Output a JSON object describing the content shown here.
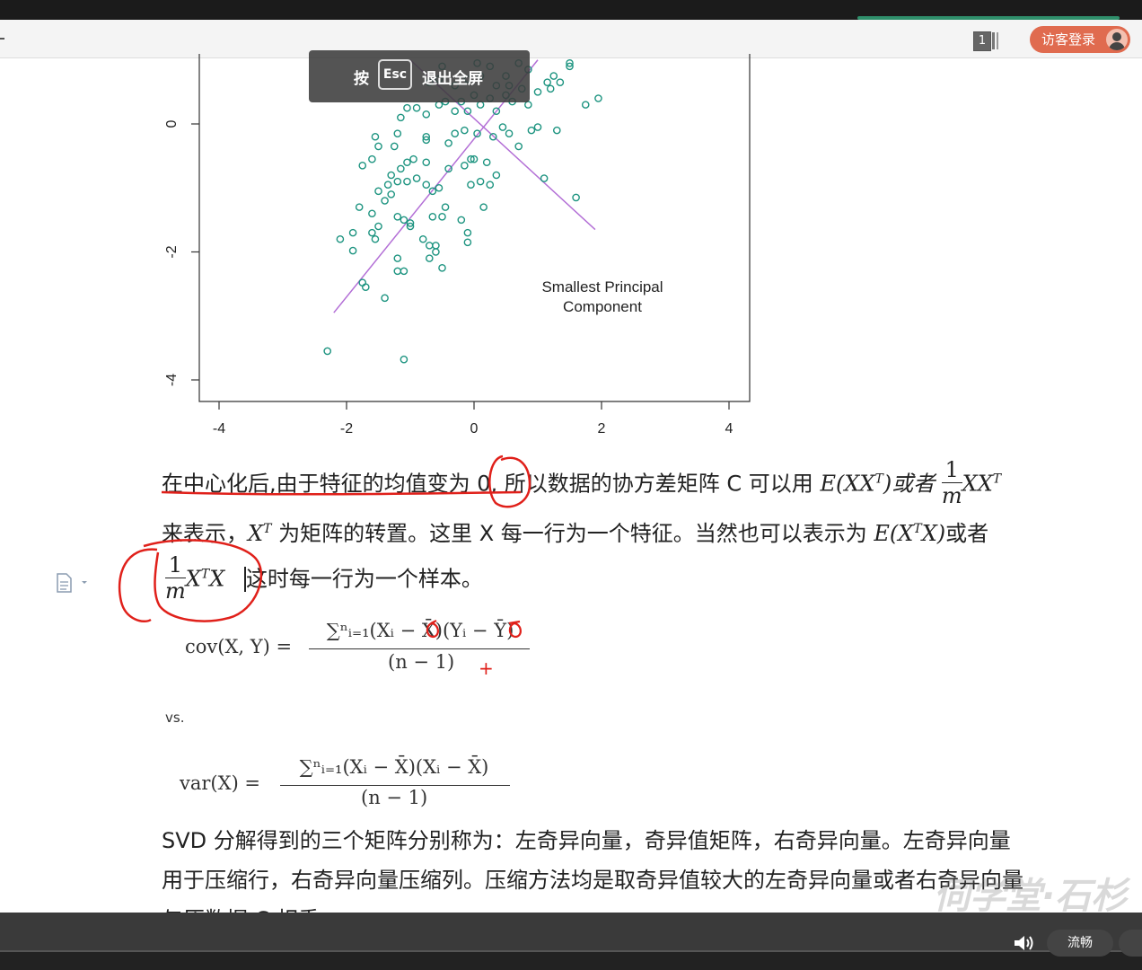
{
  "header": {
    "page_count": "1",
    "visitor_login": "访客登录"
  },
  "fullscreen_hint": {
    "press": "按",
    "key": "Esc",
    "action": "退出全屏"
  },
  "chart_data": {
    "type": "scatter",
    "title": "",
    "annotation_line1": "Smallest Principal",
    "annotation_line2": "Component",
    "xlabel": "",
    "ylabel": "",
    "x_ticks": [
      "-4",
      "-2",
      "0",
      "2",
      "4"
    ],
    "y_ticks": [
      "0",
      "-2",
      "-4"
    ],
    "xlim": [
      -4.4,
      4.4
    ],
    "ylim": [
      -4.3,
      1.1
    ],
    "point_color": "#1d9480",
    "line_color": "#b36fd6",
    "lines": [
      {
        "x": [
          -2.2,
          1.0
        ],
        "y": [
          -2.95,
          1.0
        ]
      },
      {
        "x": [
          -1.0,
          1.9
        ],
        "y": [
          1.0,
          -1.65
        ]
      }
    ],
    "points": [
      [
        -2.3,
        -3.55
      ],
      [
        -1.1,
        -3.68
      ],
      [
        -1.4,
        -2.72
      ],
      [
        -1.75,
        -2.48
      ],
      [
        -1.7,
        -2.55
      ],
      [
        -1.2,
        -2.3
      ],
      [
        -1.1,
        -2.3
      ],
      [
        -1.2,
        -2.1
      ],
      [
        -0.5,
        -2.25
      ],
      [
        -0.7,
        -2.1
      ],
      [
        -0.6,
        -2.0
      ],
      [
        -0.7,
        -1.9
      ],
      [
        -0.8,
        -1.8
      ],
      [
        -0.6,
        -1.9
      ],
      [
        -2.1,
        -1.8
      ],
      [
        -1.9,
        -1.98
      ],
      [
        -1.9,
        -1.7
      ],
      [
        -1.55,
        -1.8
      ],
      [
        -1.6,
        -1.7
      ],
      [
        -1.5,
        -1.6
      ],
      [
        -1.0,
        -1.55
      ],
      [
        -1.0,
        -1.6
      ],
      [
        -1.1,
        -1.5
      ],
      [
        -1.2,
        -1.45
      ],
      [
        -1.8,
        -1.3
      ],
      [
        -1.6,
        -1.4
      ],
      [
        -1.4,
        -1.2
      ],
      [
        -1.3,
        -1.1
      ],
      [
        -1.5,
        -1.05
      ],
      [
        -1.35,
        -0.95
      ],
      [
        -1.2,
        -0.9
      ],
      [
        -1.05,
        -0.9
      ],
      [
        -0.9,
        -0.85
      ],
      [
        -0.75,
        -0.95
      ],
      [
        -0.65,
        -1.05
      ],
      [
        -0.55,
        -1.0
      ],
      [
        -0.45,
        -1.3
      ],
      [
        -0.65,
        -1.45
      ],
      [
        -0.5,
        -1.45
      ],
      [
        -0.2,
        -1.5
      ],
      [
        -0.1,
        -1.7
      ],
      [
        -0.1,
        -1.85
      ],
      [
        0.15,
        -1.3
      ],
      [
        -0.05,
        -0.95
      ],
      [
        0.1,
        -0.9
      ],
      [
        0.25,
        -0.95
      ],
      [
        0.35,
        -0.8
      ],
      [
        -1.75,
        -0.65
      ],
      [
        -1.6,
        -0.55
      ],
      [
        -1.3,
        -0.8
      ],
      [
        -1.15,
        -0.7
      ],
      [
        -1.05,
        -0.6
      ],
      [
        -0.95,
        -0.55
      ],
      [
        -0.75,
        -0.6
      ],
      [
        -0.4,
        -0.7
      ],
      [
        -0.15,
        -0.65
      ],
      [
        -0.05,
        -0.55
      ],
      [
        0.0,
        -0.55
      ],
      [
        0.2,
        -0.6
      ],
      [
        1.1,
        -0.85
      ],
      [
        1.6,
        -1.15
      ],
      [
        -1.55,
        -0.2
      ],
      [
        -1.5,
        -0.35
      ],
      [
        -1.25,
        -0.35
      ],
      [
        -1.2,
        -0.15
      ],
      [
        -0.75,
        -0.2
      ],
      [
        -0.75,
        -0.25
      ],
      [
        -0.4,
        -0.3
      ],
      [
        -0.3,
        -0.15
      ],
      [
        -0.15,
        -0.1
      ],
      [
        0.05,
        -0.15
      ],
      [
        0.3,
        -0.2
      ],
      [
        0.45,
        -0.05
      ],
      [
        0.55,
        -0.15
      ],
      [
        0.7,
        -0.35
      ],
      [
        0.9,
        -0.1
      ],
      [
        1.0,
        -0.05
      ],
      [
        1.3,
        -0.1
      ],
      [
        -1.15,
        0.1
      ],
      [
        -1.05,
        0.25
      ],
      [
        -0.9,
        0.25
      ],
      [
        -0.75,
        0.15
      ],
      [
        -0.55,
        0.3
      ],
      [
        -0.45,
        0.35
      ],
      [
        -0.3,
        0.2
      ],
      [
        -0.2,
        0.35
      ],
      [
        -0.1,
        0.2
      ],
      [
        0.0,
        0.45
      ],
      [
        0.1,
        0.3
      ],
      [
        0.25,
        0.4
      ],
      [
        0.35,
        0.2
      ],
      [
        0.5,
        0.45
      ],
      [
        0.6,
        0.35
      ],
      [
        0.75,
        0.55
      ],
      [
        0.85,
        0.3
      ],
      [
        1.0,
        0.5
      ],
      [
        1.15,
        0.65
      ],
      [
        1.25,
        0.75
      ],
      [
        1.5,
        0.9
      ],
      [
        -0.7,
        0.65
      ],
      [
        -0.55,
        0.7
      ],
      [
        -0.3,
        0.6
      ],
      [
        -0.1,
        0.7
      ],
      [
        0.1,
        0.75
      ],
      [
        0.25,
        0.9
      ],
      [
        0.35,
        0.6
      ],
      [
        0.5,
        0.75
      ],
      [
        0.7,
        0.95
      ],
      [
        0.85,
        0.85
      ],
      [
        1.2,
        0.55
      ],
      [
        1.35,
        0.65
      ],
      [
        1.5,
        0.95
      ],
      [
        1.75,
        0.3
      ],
      [
        1.95,
        0.4
      ],
      [
        -0.5,
        0.9
      ],
      [
        0.05,
        0.95
      ],
      [
        0.55,
        0.6
      ]
    ]
  },
  "text1": {
    "line1_a": "在中心化后,由于特征的均值变为 0, 所以数据的协方差矩阵 C 可以用 ",
    "line1_math": "E(XX",
    "line1_sup": "T",
    "line1_b": ")或者 ",
    "line1_frac_n": "1",
    "line1_frac_d": "m",
    "line1_math2": "XX",
    "line1_sup2": "T",
    "line2_a": "来表示，",
    "line2_math": "X",
    "line2_sup": "T",
    "line2_b": " 为矩阵的转置。这里 X 每一行为一个特征。当然也可以表示为 ",
    "line2_math2": "E(X",
    "line2_sup2": "T",
    "line2_math3": "X)",
    "line2_c": "或者",
    "line3_frac_n": "1",
    "line3_frac_d": "m",
    "line3_math": "X",
    "line3_sup": "T",
    "line3_math2": "X",
    "line3_b": "这时每一行为一个样本。"
  },
  "formulas": {
    "cov_lhs": "cov(X, Y) =",
    "cov_num": "∑ⁿᵢ₌₁(Xᵢ − X̄)(Yᵢ − Ȳ)",
    "cov_den": "(n − 1)",
    "vs": "vs.",
    "var_lhs": "var(X) =",
    "var_num": "∑ⁿᵢ₌₁(Xᵢ − X̄)(Xᵢ − X̄)",
    "var_den": "(n − 1)"
  },
  "text2": {
    "line1": "SVD 分解得到的三个矩阵分别称为：左奇异向量，奇异值矩阵，右奇异向量。左奇异向量",
    "line2": "用于压缩行，右奇异向量压缩列。压缩方法均是取奇异值较大的左奇异向量或者右奇异向量",
    "line3": "与原数据 C 相乘。"
  },
  "annotations": {
    "plus": "+"
  },
  "player": {
    "watermark": "伺学堂·石杉",
    "quality": "流畅"
  },
  "colors": {
    "accent": "#e06b4f",
    "ink": "#e0201a",
    "points": "#1d9480"
  }
}
